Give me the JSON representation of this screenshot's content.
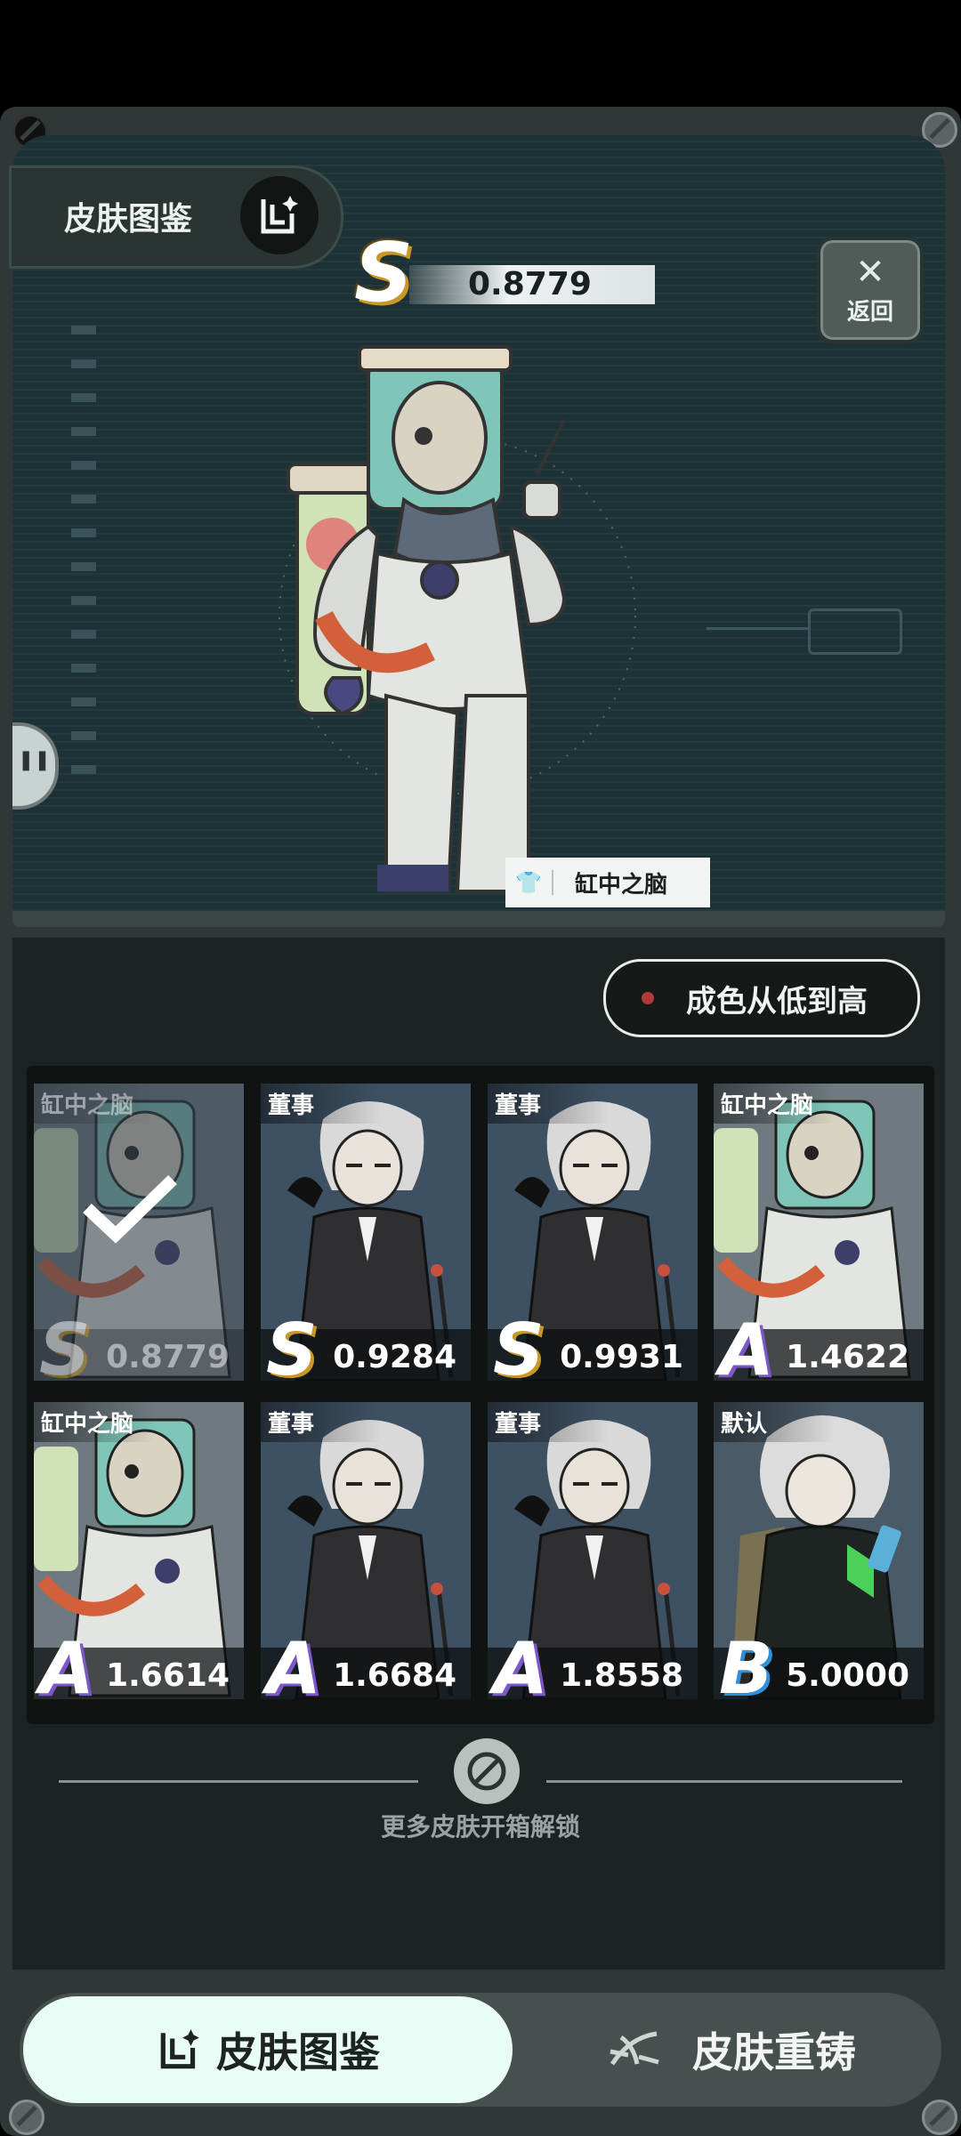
{
  "header": {
    "title": "皮肤图鉴",
    "back_label": "返回"
  },
  "preview": {
    "grade": "S",
    "score": "0.8779",
    "skin_name": "缸中之脑"
  },
  "sort": {
    "label": "成色从低到高"
  },
  "skins": [
    {
      "name": "缸中之脑",
      "grade": "S",
      "value": "0.8779",
      "art": "tank",
      "selected": true
    },
    {
      "name": "董事",
      "grade": "S",
      "value": "0.9284",
      "art": "exec",
      "selected": false
    },
    {
      "name": "董事",
      "grade": "S",
      "value": "0.9931",
      "art": "exec",
      "selected": false
    },
    {
      "name": "缸中之脑",
      "grade": "A",
      "value": "1.4622",
      "art": "tank",
      "selected": false
    },
    {
      "name": "缸中之脑",
      "grade": "A",
      "value": "1.6614",
      "art": "tank",
      "selected": false
    },
    {
      "name": "董事",
      "grade": "A",
      "value": "1.6684",
      "art": "exec",
      "selected": false
    },
    {
      "name": "董事",
      "grade": "A",
      "value": "1.8558",
      "art": "exec",
      "selected": false
    },
    {
      "name": "默认",
      "grade": "B",
      "value": "5.0000",
      "art": "default",
      "selected": false
    }
  ],
  "more_hint": "更多皮肤开箱解锁",
  "tabs": [
    {
      "label": "皮肤图鉴",
      "icon": "collection-icon",
      "active": true
    },
    {
      "label": "皮肤重铸",
      "icon": "recast-icon",
      "active": false
    }
  ],
  "colors": {
    "grade_S": "#c99726",
    "grade_A": "#7b57c8",
    "grade_B": "#2f8fd8",
    "active_tab": "#e9fbf5"
  }
}
